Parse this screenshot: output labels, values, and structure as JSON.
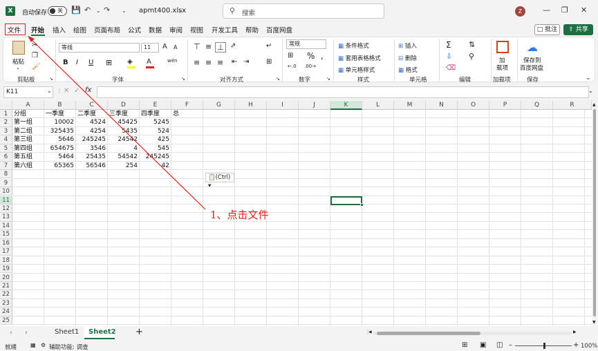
{
  "titlebar": {
    "autosave_label": "自动保存",
    "autosave_state": "关",
    "filename": "apmt400.xlsx",
    "search_placeholder": "搜索",
    "avatar_initial": "Z"
  },
  "tabs": [
    "文件",
    "开始",
    "插入",
    "绘图",
    "页面布局",
    "公式",
    "数据",
    "审阅",
    "视图",
    "开发工具",
    "帮助",
    "百度网盘"
  ],
  "active_tab": "开始",
  "comment_label": "批注",
  "share_label": "共享",
  "ribbon": {
    "clipboard": {
      "paste": "粘贴",
      "group": "剪贴板"
    },
    "font": {
      "name": "等线",
      "size": "11",
      "group": "字体",
      "bold": "B",
      "italic": "I",
      "underline": "U",
      "grow": "A",
      "shrink": "A",
      "phonetic": "wén"
    },
    "alignment": {
      "group": "对齐方式"
    },
    "number": {
      "format": "常规",
      "percent": "%",
      "group": "数字"
    },
    "styles": {
      "cond": "条件格式",
      "table": "套用表格格式",
      "cell": "单元格样式",
      "group": "样式"
    },
    "cells": {
      "insert": "插入",
      "delete": "删除",
      "format": "格式",
      "group": "单元格"
    },
    "editing": {
      "group": "编辑"
    },
    "addins": {
      "label1": "加",
      "label2": "载项",
      "group": "加载项"
    },
    "save": {
      "label1": "保存到",
      "label2": "百度网盘",
      "group": "保存"
    }
  },
  "formula_bar": {
    "namebox": "K11",
    "fx": "fx",
    "content": ""
  },
  "columns": [
    "A",
    "B",
    "C",
    "D",
    "E",
    "F",
    "G",
    "H",
    "I",
    "J",
    "K",
    "L",
    "M",
    "N",
    "O",
    "P",
    "Q",
    "R"
  ],
  "selected_column": "K",
  "rows": [
    "1",
    "2",
    "3",
    "4",
    "5",
    "6",
    "7",
    "8",
    "9",
    "10",
    "11",
    "12",
    "13",
    "14",
    "15",
    "16",
    "17",
    "18",
    "19",
    "20",
    "21",
    "22",
    "23",
    "24",
    "25"
  ],
  "selected_row": "11",
  "sheet": {
    "headers": [
      "分组",
      "一季度",
      "二季度",
      "三季度",
      "四季度",
      "总"
    ],
    "data": [
      [
        "第一组",
        "10002",
        "4524",
        "45425",
        "5245"
      ],
      [
        "第二组",
        "325435",
        "4254",
        "5435",
        "524"
      ],
      [
        "第三组",
        "5646",
        "245245",
        "24542",
        "425"
      ],
      [
        "第四组",
        "654675",
        "3546",
        "4",
        "545"
      ],
      [
        "第五组",
        "5464",
        "25435",
        "54542",
        "245245"
      ],
      [
        "第六组",
        "65365",
        "56546",
        "254",
        "42"
      ]
    ]
  },
  "paste_options": "(Ctrl)",
  "annotation": "1、点击文件",
  "sheet_tabs": [
    "Sheet1",
    "Sheet2"
  ],
  "active_sheet": "Sheet2",
  "status": {
    "ready": "就绪",
    "accessibility": "辅助功能: 调查",
    "zoom": "100%"
  },
  "colors": {
    "accent": "#1d6f42",
    "annotation_red": "#e02020"
  }
}
